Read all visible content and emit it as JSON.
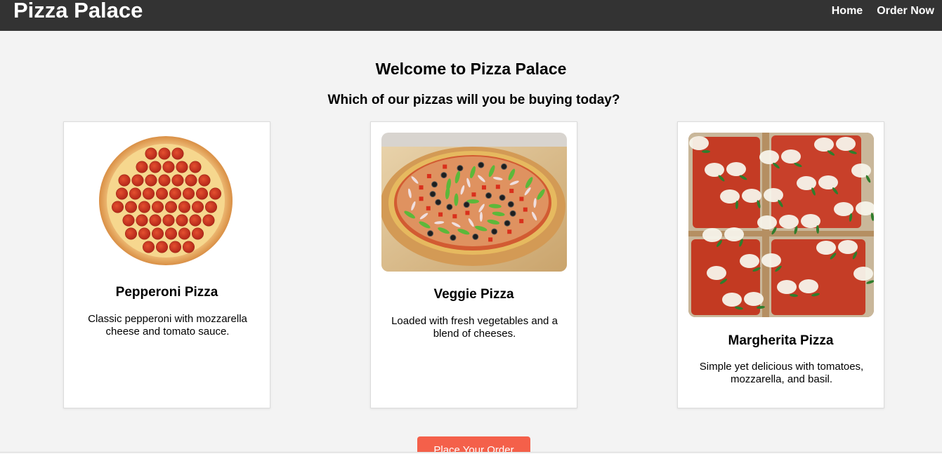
{
  "header": {
    "brand": "Pizza Palace",
    "nav": [
      {
        "label": "Home"
      },
      {
        "label": "Order Now"
      }
    ]
  },
  "hero": {
    "title": "Welcome to Pizza Palace",
    "subtitle": "Which of our pizzas will you be buying today?"
  },
  "pizzas": [
    {
      "name": "Pepperoni Pizza",
      "description": "Classic pepperoni with mozzarella cheese and tomato sauce.",
      "image": "pepperoni-pizza-photo"
    },
    {
      "name": "Veggie Pizza",
      "description": "Loaded with fresh vegetables and a blend of cheeses.",
      "image": "veggie-pizza-photo"
    },
    {
      "name": "Margherita Pizza",
      "description": "Simple yet delicious with tomatoes, mozzarella, and basil.",
      "image": "margherita-pizza-photo"
    }
  ],
  "cta": {
    "label": "Place Your Order"
  },
  "colors": {
    "header_bg": "#333333",
    "page_bg": "#f3f3f3",
    "button": "#f4604a"
  }
}
